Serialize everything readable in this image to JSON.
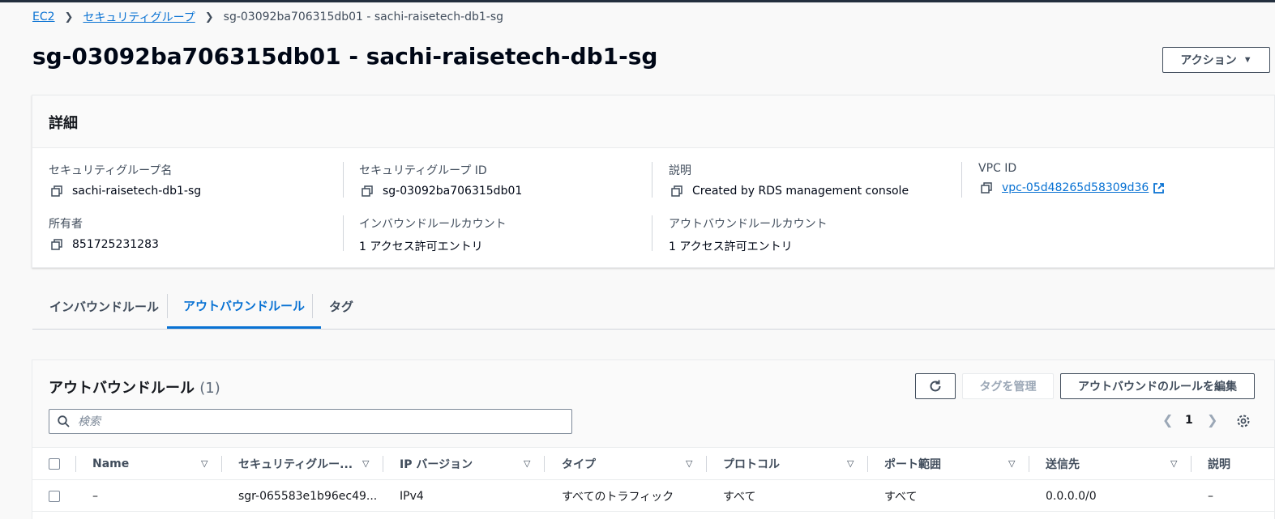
{
  "breadcrumb": {
    "items": [
      "EC2",
      "セキュリティグループ"
    ],
    "current": "sg-03092ba706315db01 - sachi-raisetech-db1-sg"
  },
  "page_title": "sg-03092ba706315db01 - sachi-raisetech-db1-sg",
  "actions_label": "アクション",
  "details": {
    "title": "詳細",
    "sg_name_label": "セキュリティグループ名",
    "sg_name": "sachi-raisetech-db1-sg",
    "sg_id_label": "セキュリティグループ ID",
    "sg_id": "sg-03092ba706315db01",
    "description_label": "説明",
    "description": "Created by RDS management console",
    "vpc_label": "VPC ID",
    "vpc_id": "vpc-05d48265d58309d36",
    "owner_label": "所有者",
    "owner": "851725231283",
    "inbound_count_label": "インバウンドルールカウント",
    "inbound_count": "1 アクセス許可エントリ",
    "outbound_count_label": "アウトバウンドルールカウント",
    "outbound_count": "1 アクセス許可エントリ"
  },
  "tabs": [
    "インバウンドルール",
    "アウトバウンドルール",
    "タグ"
  ],
  "rules": {
    "title": "アウトバウンドルール",
    "count": "(1)",
    "manage_tags": "タグを管理",
    "edit_rules": "アウトバウンドのルールを編集",
    "search_placeholder": "検索",
    "page": "1",
    "columns": [
      "Name",
      "セキュリティグルー...",
      "IP バージョン",
      "タイプ",
      "プロトコル",
      "ポート範囲",
      "送信先",
      "説明"
    ],
    "rows": [
      [
        "–",
        "sgr-065583e1b96ec49...",
        "IPv4",
        "すべてのトラフィック",
        "すべて",
        "すべて",
        "0.0.0.0/0",
        "–"
      ]
    ]
  },
  "colors": {
    "link": "#0972d3",
    "text": "#16191f",
    "secondary_text": "#414d5c"
  },
  "icons": [
    "chevron-right-icon",
    "copy-icon",
    "external-link-icon",
    "refresh-icon",
    "search-icon",
    "chevron-left-icon",
    "gear-icon",
    "sort-icon"
  ]
}
